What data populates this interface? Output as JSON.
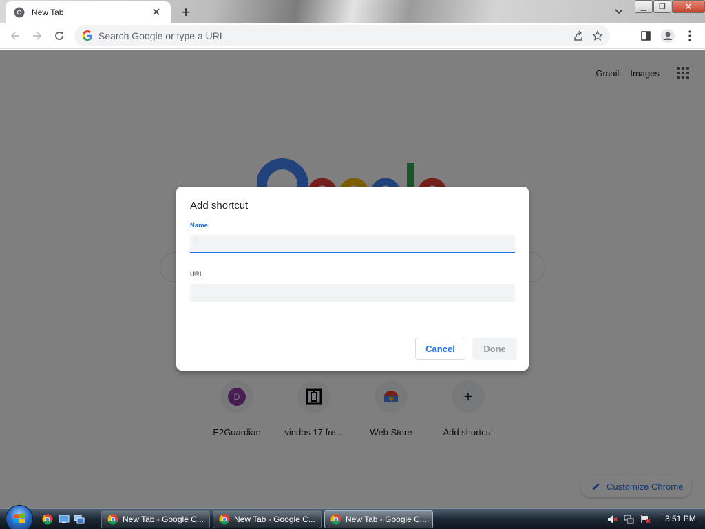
{
  "browser": {
    "tab": {
      "title": "New Tab"
    },
    "omnibox": {
      "placeholder": "Search Google or type a URL"
    }
  },
  "ntp": {
    "links": {
      "gmail": "Gmail",
      "images": "Images"
    },
    "shortcuts": [
      {
        "label": "E2Guardian",
        "initial": "D"
      },
      {
        "label": "vindos 17 fre..."
      },
      {
        "label": "Web Store"
      },
      {
        "label": "Add shortcut"
      }
    ],
    "customize_label": "Customize Chrome"
  },
  "dialog": {
    "title": "Add shortcut",
    "name_label": "Name",
    "name_value": "",
    "url_label": "URL",
    "url_value": "",
    "cancel_label": "Cancel",
    "done_label": "Done"
  },
  "taskbar": {
    "items": [
      {
        "label": "New Tab - Google C..."
      },
      {
        "label": "New Tab - Google C..."
      },
      {
        "label": "New Tab - Google C..."
      }
    ],
    "clock": "3:51 PM"
  },
  "colors": {
    "accent": "#1a73e8",
    "overlay": "rgba(0,0,0,0.5)"
  },
  "icons": [
    "chrome-icon",
    "close-icon",
    "plus-icon",
    "chevron-down-icon",
    "back-arrow-icon",
    "forward-arrow-icon",
    "reload-icon",
    "google-g-icon",
    "share-icon",
    "star-icon",
    "side-panel-icon",
    "profile-icon",
    "kebab-menu-icon",
    "apps-grid-icon",
    "pencil-icon",
    "windows-start-icon",
    "volume-muted-icon",
    "network-icon",
    "action-center-flag-icon"
  ]
}
